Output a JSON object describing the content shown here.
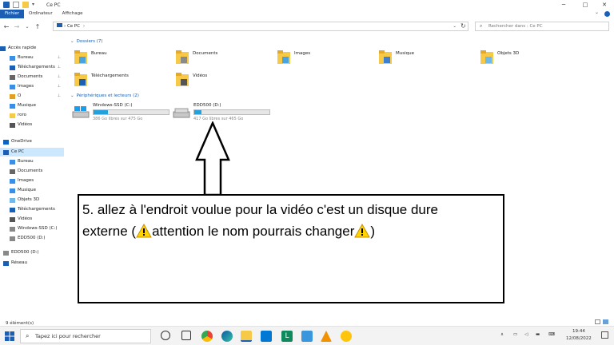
{
  "window": {
    "title": "Ce PC",
    "minimize": "─",
    "maximize": "□",
    "close": "✕"
  },
  "ribbon": {
    "tabs": [
      "Fichier",
      "Ordinateur",
      "Affichage"
    ]
  },
  "nav": {
    "back": "←",
    "forward": "→",
    "recent": "⌄",
    "up": "↑",
    "address": "Ce PC",
    "address_chev": "›",
    "refresh": "↻",
    "search_placeholder": "Rechercher dans : Ce PC"
  },
  "sidebar": {
    "items": [
      {
        "label": "Accès rapide",
        "pin": false
      },
      {
        "label": "Bureau",
        "pin": true
      },
      {
        "label": "Téléchargements",
        "pin": true
      },
      {
        "label": "Documents",
        "pin": true
      },
      {
        "label": "Images",
        "pin": true
      },
      {
        "label": "O",
        "pin": true
      },
      {
        "label": "Musique",
        "pin": false
      },
      {
        "label": "roro",
        "pin": false
      },
      {
        "label": "Vidéos",
        "pin": false
      },
      {
        "label": "OneDrive",
        "pin": false
      },
      {
        "label": "Ce PC",
        "pin": false
      },
      {
        "label": "Bureau",
        "pin": false
      },
      {
        "label": "Documents",
        "pin": false
      },
      {
        "label": "Images",
        "pin": false
      },
      {
        "label": "Musique",
        "pin": false
      },
      {
        "label": "Objets 3D",
        "pin": false
      },
      {
        "label": "Téléchargements",
        "pin": false
      },
      {
        "label": "Vidéos",
        "pin": false
      },
      {
        "label": "Windows-SSD (C:)",
        "pin": false
      },
      {
        "label": "EDD500 (D:)",
        "pin": false
      },
      {
        "label": "EDD500 (D:)",
        "pin": false
      },
      {
        "label": "Réseau",
        "pin": false
      }
    ],
    "pin_glyph": "📌"
  },
  "folders_group": "Dossiers (7)",
  "folders": [
    "Bureau",
    "Documents",
    "Images",
    "Musique",
    "Objets 3D",
    "Téléchargements",
    "Vidéos"
  ],
  "drives_group": "Périphériques et lecteurs (2)",
  "drives": [
    {
      "name": "Windows-SSD (C:)",
      "free": "386 Go libres sur 475 Go",
      "used_fraction": 0.19
    },
    {
      "name": "EDD500 (D:)",
      "free": "417 Go libres sur 465 Go",
      "used_fraction": 0.1
    }
  ],
  "callout": {
    "line1": "5. allez à l'endroit voulue pour la vidéo c'est un disque dure",
    "line2a": "externe (",
    "line2b": "attention le nom pourrais changer",
    "line2c": ")"
  },
  "status": {
    "count": "9 élément(s)"
  },
  "taskbar": {
    "search": "Tapez ici pour rechercher",
    "time": "19:44",
    "date": "12/08/2022"
  },
  "colors": {
    "accent": "#1a5fb4",
    "folder": "#f7c948",
    "drive_fill": "#26a0da",
    "warning": "#ffd400"
  }
}
